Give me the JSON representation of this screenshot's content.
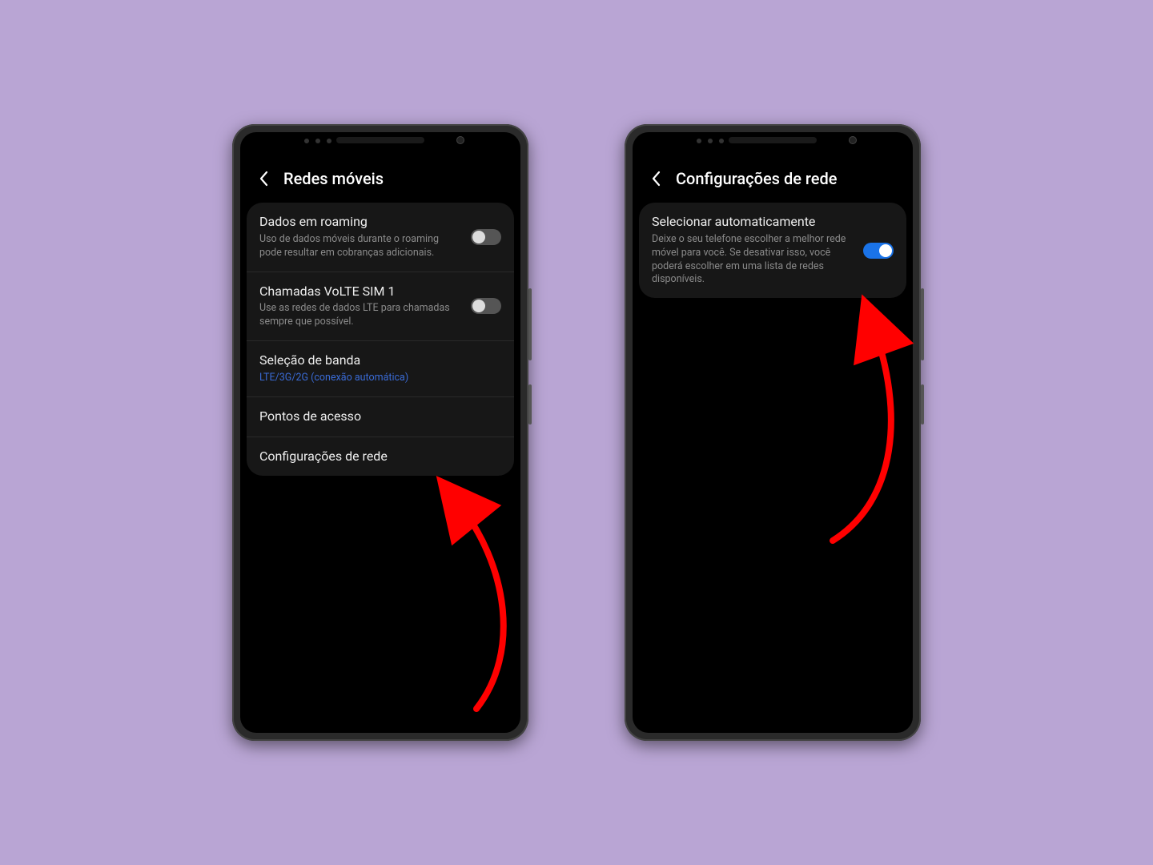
{
  "phone1": {
    "header": {
      "title": "Redes móveis"
    },
    "rows": [
      {
        "title": "Dados em roaming",
        "sub": "Uso de dados móveis durante o roaming pode resultar em cobranças adicionais."
      },
      {
        "title": "Chamadas VoLTE SIM 1",
        "sub": "Use as redes de dados LTE para chamadas sempre que possível."
      },
      {
        "title": "Seleção de banda",
        "sub": "LTE/3G/2G (conexão automática)"
      },
      {
        "title": "Pontos de acesso"
      },
      {
        "title": "Configurações de rede"
      }
    ]
  },
  "phone2": {
    "header": {
      "title": "Configurações de rede"
    },
    "rows": [
      {
        "title": "Selecionar automaticamente",
        "sub": "Deixe o seu telefone escolher a melhor rede móvel para você. Se desativar isso, você poderá escolher em uma lista de redes disponíveis."
      }
    ]
  }
}
